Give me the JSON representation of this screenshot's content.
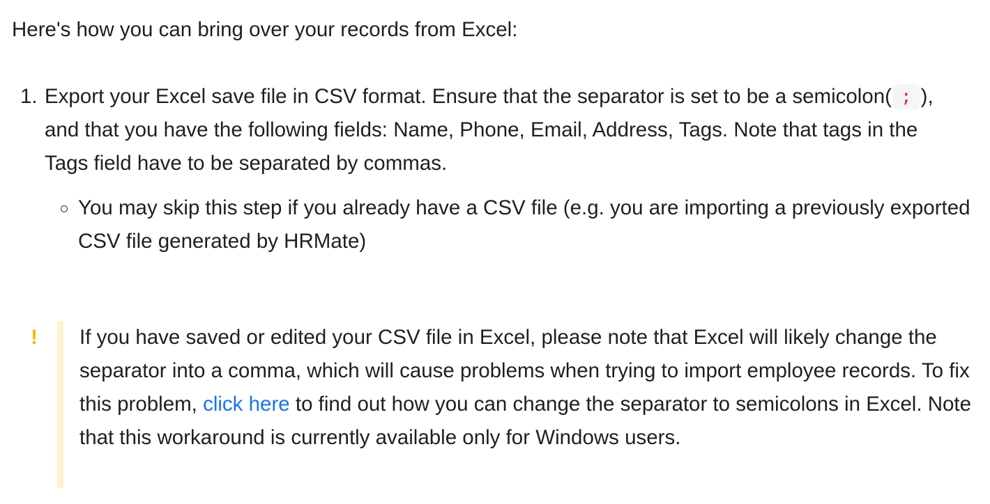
{
  "intro": "Here's how you can bring over your records from Excel:",
  "steps": [
    {
      "marker": "1.",
      "text_before_code": "Export your Excel save file in CSV format. Ensure that the separator is set to be a semicolon(",
      "code": ";",
      "text_after_code": "), and that you have the following fields: Name, Phone, Email, Address, Tags. Note that tags in the Tags field have to be separated by commas.",
      "substeps": [
        {
          "text": "You may skip this step if you already have a CSV file (e.g. you are importing a previously exported CSV file generated by HRMate)"
        }
      ]
    }
  ],
  "callout": {
    "icon": "warning-icon",
    "icon_glyph": "!",
    "accent_color": "#f5b800",
    "bar_color": "#fff2cc",
    "text_before_link": "If you have saved or edited your CSV file in Excel, please note that Excel will likely change the separator into a comma, which will cause problems when trying to import employee records. To fix this problem, ",
    "link_text": "click here",
    "text_after_link": " to find out how you can change the separator to semicolons in Excel. Note that this workaround is currently available only for Windows users."
  },
  "colors": {
    "text": "#1f1f1f",
    "link": "#1a73e8",
    "code": "#e01e5a"
  }
}
